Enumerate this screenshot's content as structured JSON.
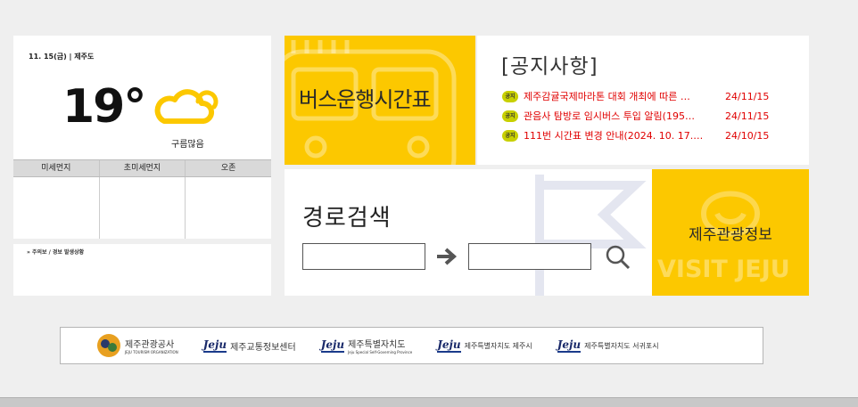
{
  "weather": {
    "date": "11. 15(금)  |  제주도",
    "temperature": "19°",
    "condition": "구름많음",
    "columns": [
      "미세먼지",
      "초미세먼지",
      "오존"
    ],
    "values": [
      "",
      "",
      ""
    ],
    "icon": "cloud-sun-icon"
  },
  "warning": {
    "label": "» 주의보 / 경보 발생상황"
  },
  "bus": {
    "label": "버스운행시간표"
  },
  "notice": {
    "title": "[공지사항]",
    "badge": "공지",
    "items": [
      {
        "text": "제주감귤국제마라톤 대회 개최에 따른 …",
        "date": "24/11/15"
      },
      {
        "text": "관음사 탐방로 임시버스 투입 알림(195…",
        "date": "24/11/15"
      },
      {
        "text": "111번 시간표 변경 안내(2024. 10. 17.…",
        "date": "24/10/15"
      }
    ]
  },
  "route": {
    "title": "경로검색",
    "from_value": "",
    "to_value": ""
  },
  "tour": {
    "label": "제주관광정보",
    "watermark": "VISIT JEJU"
  },
  "logos": [
    {
      "mark": "",
      "name": "제주관광공사",
      "sub": "JEJU TOURISM ORGANIZATION"
    },
    {
      "mark": "Jeju",
      "name": "제주교통정보센터"
    },
    {
      "mark": "Jeju",
      "name": "제주특별자치도",
      "sub": "Jeju Special Self-Governing Province"
    },
    {
      "mark": "Jeju",
      "name": "제주특별자치도 제주시"
    },
    {
      "mark": "Jeju",
      "name": "제주특별자치도 서귀포시"
    }
  ],
  "colors": {
    "accent": "#fcc800",
    "notice_red": "#e00000",
    "badge": "#c8d000"
  }
}
